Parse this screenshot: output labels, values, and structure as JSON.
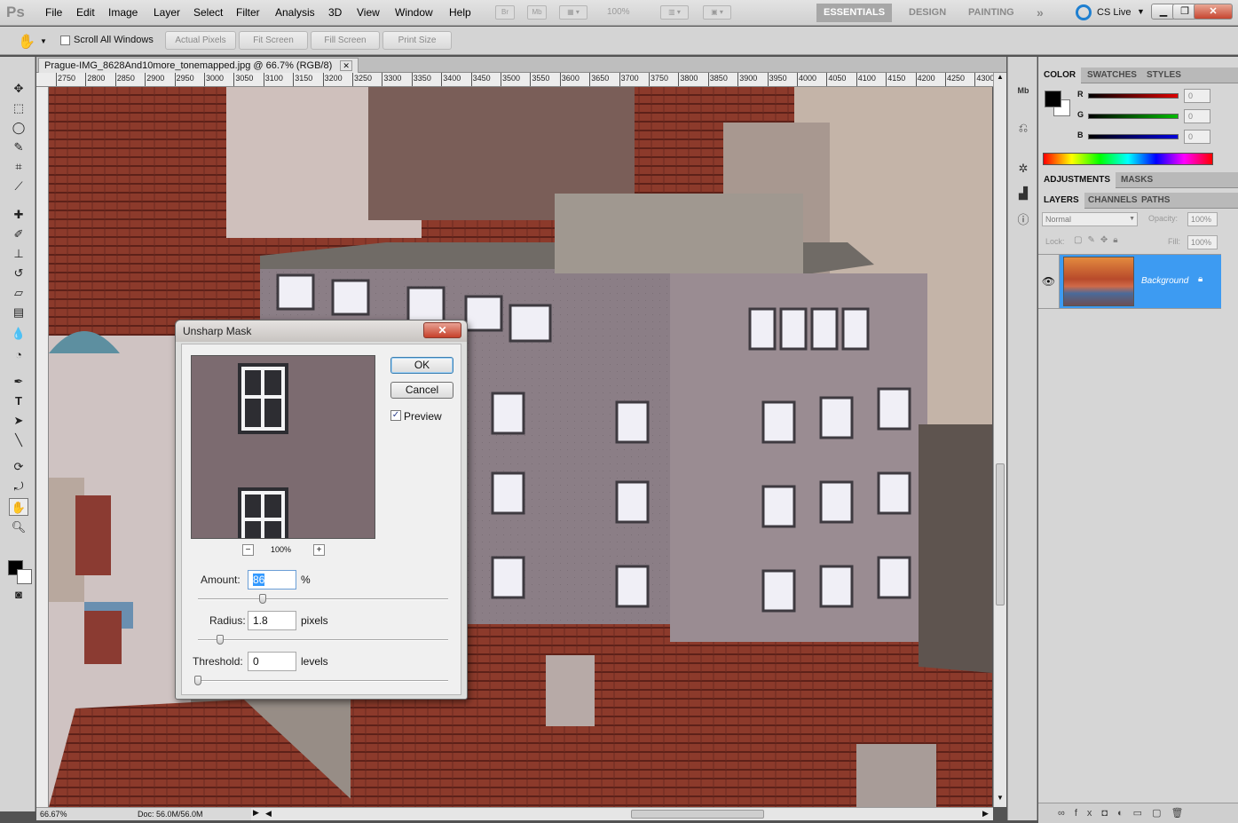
{
  "app": {
    "logo": "Ps",
    "menu": [
      "File",
      "Edit",
      "Image",
      "Layer",
      "Select",
      "Filter",
      "Analysis",
      "3D",
      "View",
      "Window",
      "Help"
    ],
    "bridge_label": "Br",
    "minibridge_label": "Mb",
    "zoom_level": "100%",
    "workspaces": [
      "ESSENTIALS",
      "DESIGN",
      "PAINTING"
    ],
    "more_workspaces": "»",
    "cslive": "CS Live"
  },
  "options_bar": {
    "scroll_all_windows": "Scroll All Windows",
    "buttons": [
      "Actual Pixels",
      "Fit Screen",
      "Fill Screen",
      "Print Size"
    ]
  },
  "document": {
    "tab_title": "Prague-IMG_8628And10more_tonemapped.jpg @ 66.7% (RGB/8)",
    "ruler_labels": [
      "2750",
      "2800",
      "2850",
      "2900",
      "2950",
      "3000",
      "3050",
      "3100",
      "3150",
      "3200",
      "3250",
      "3300",
      "3350",
      "3400",
      "3450",
      "3500",
      "3550",
      "3600",
      "3650",
      "3700",
      "3750",
      "3800",
      "3850",
      "3900",
      "3950",
      "4000",
      "4050",
      "4100",
      "4150",
      "4200",
      "4250",
      "4300"
    ],
    "zoom": "66.67%",
    "doc_size": "Doc: 56.0M/56.0M"
  },
  "dialog": {
    "title": "Unsharp Mask",
    "ok": "OK",
    "cancel": "Cancel",
    "preview_label": "Preview",
    "preview_checked": true,
    "preview_zoom": "100%",
    "zoom_out": "−",
    "zoom_in": "+",
    "amount_label": "Amount:",
    "amount_value": "86",
    "amount_unit": "%",
    "amount_slider": 0.26,
    "radius_label": "Radius:",
    "radius_value": "1.8",
    "radius_unit": "pixels",
    "radius_slider": 0.09,
    "threshold_label": "Threshold:",
    "threshold_value": "0",
    "threshold_unit": "levels",
    "threshold_slider": 0.0
  },
  "panels": {
    "color_tabs": [
      "COLOR",
      "SWATCHES",
      "STYLES"
    ],
    "channels": [
      {
        "label": "R",
        "value": "0",
        "color": "#c00000"
      },
      {
        "label": "G",
        "value": "0",
        "color": "#00b000"
      },
      {
        "label": "B",
        "value": "0",
        "color": "#0000c8"
      }
    ],
    "adjust_tabs": [
      "ADJUSTMENTS",
      "MASKS"
    ],
    "layer_tabs": [
      "LAYERS",
      "CHANNELS",
      "PATHS"
    ],
    "blend_mode": "Normal",
    "opacity_label": "Opacity:",
    "opacity_value": "100%",
    "lock_label": "Lock:",
    "fill_label": "Fill:",
    "fill_value": "100%",
    "layer_name": "Background",
    "highlight_color": "#3d9bf2"
  }
}
